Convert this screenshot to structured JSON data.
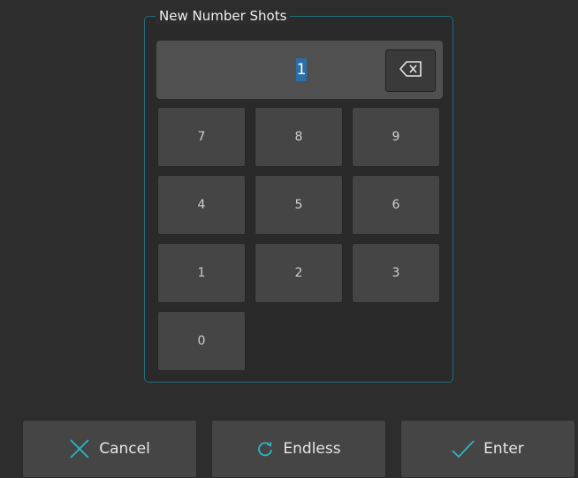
{
  "dialog": {
    "title": "New Number Shots",
    "display_value": "1"
  },
  "keypad": {
    "keys": [
      "7",
      "8",
      "9",
      "4",
      "5",
      "6",
      "1",
      "2",
      "3",
      "0"
    ]
  },
  "icons": {
    "backspace": "backspace-icon",
    "cancel": "x-icon",
    "endless": "loop-icon",
    "enter": "checkmark-icon"
  },
  "buttons": {
    "cancel_label": "Cancel",
    "endless_label": "Endless",
    "enter_label": "Enter"
  },
  "colors": {
    "accent": "#2bb6c4",
    "border_accent": "#1f6f80",
    "selection": "#2b6fa8"
  }
}
